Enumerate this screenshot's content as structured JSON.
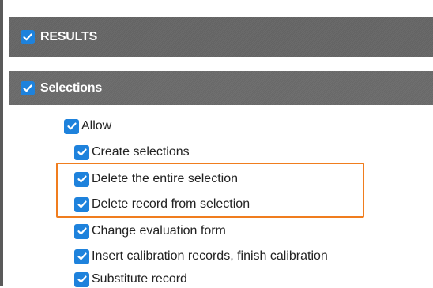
{
  "results_header": {
    "label": "RESULTS",
    "checked": true
  },
  "selections_header": {
    "label": "Selections",
    "checked": true
  },
  "permissions": {
    "group": {
      "label": "Allow",
      "checked": true
    },
    "items": [
      {
        "label": "Create selections",
        "checked": true
      },
      {
        "label": "Delete the entire selection",
        "checked": true
      },
      {
        "label": "Delete record from selection",
        "checked": true
      },
      {
        "label": "Change evaluation form",
        "checked": true
      },
      {
        "label": "Insert calibration records, finish calibration",
        "checked": true
      },
      {
        "label": "Substitute record",
        "checked": true
      }
    ]
  },
  "colors": {
    "checkbox": "#1e82dc",
    "header_bg": "#666666",
    "highlight": "#f07d1e"
  },
  "icons": {
    "checkbox": "checkmark-icon"
  }
}
